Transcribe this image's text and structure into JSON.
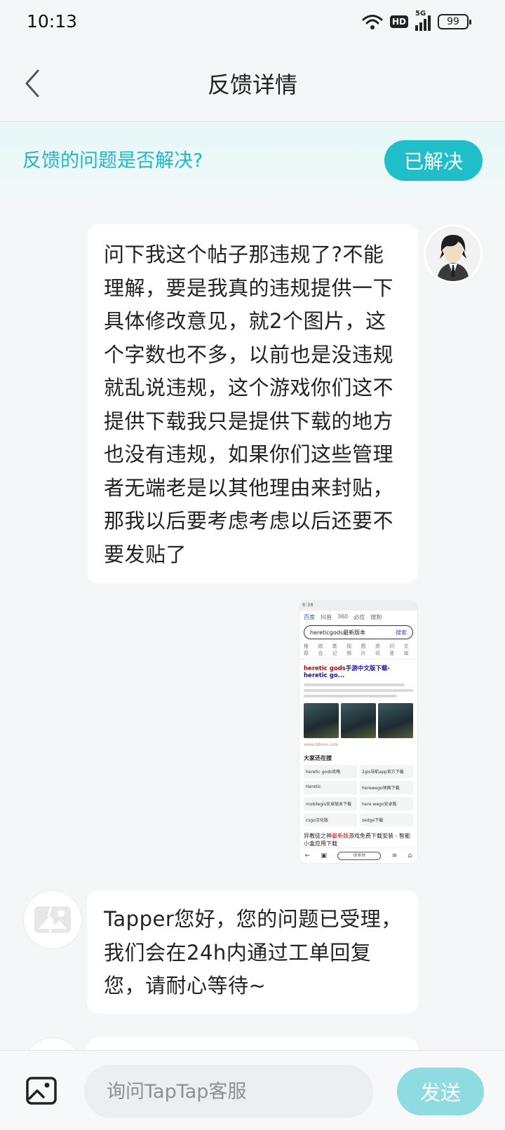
{
  "status_bar": {
    "time": "10:13",
    "hd_label": "HD",
    "network_label": "5G",
    "battery_level": "99"
  },
  "header": {
    "title": "反馈详情"
  },
  "resolve_banner": {
    "question": "反馈的问题是否解决?",
    "resolved_label": "已解决"
  },
  "conversation": {
    "user_message": "问下我这个帖子那违规了?不能理解，要是我真的违规提供一下具体修改意见，就2个图片，这个字数也不多，以前也是没违规就乱说违规，这个游戏你们这不提供下载我只是提供下载的地方也没有违规，如果你们这些管理者无端老是以其他理由来封贴，那我以后要考虑考虑以后还要不要发贴了",
    "support_message": "Tapper您好，您的问题已受理，我们会在24h内通过工单回复您，请耐心等待~"
  },
  "attachment_preview": {
    "status_time": "6:38",
    "tabs": [
      "百度",
      "抖音",
      "360",
      "必应",
      "搜狗"
    ],
    "search_query": "hereticgods最新版本",
    "search_button": "搜索",
    "filters": [
      "推荐",
      "综合",
      "笔记",
      "视频",
      "图片",
      "资讯",
      "问答",
      "文库"
    ],
    "result_title_highlight": "heretic gods",
    "result_title_rest": "手游中文版下载-heretic go...",
    "source": "www.ddooo.com",
    "related_title": "大家还在搜",
    "related": [
      "heretic gods攻略",
      "2gis导航app官方下载",
      "Heretic",
      "herewego地图下载",
      "mobilegis安卓版本下载",
      "here wego安卓版",
      "csgo汉化版",
      "zedge下载"
    ],
    "footer_title_prefix": "异教徒之神",
    "footer_title_highlight": "最新版",
    "footer_title_suffix": "游戏免费下载安装 - 智能小盒应用下载",
    "nav_pill": "搜索框"
  },
  "composer": {
    "placeholder": "询问TapTap客服",
    "send_label": "发送"
  },
  "colors": {
    "accent": "#1fbec9",
    "accent_text": "#1fb8c5",
    "send_disabled": "#8edce2"
  }
}
